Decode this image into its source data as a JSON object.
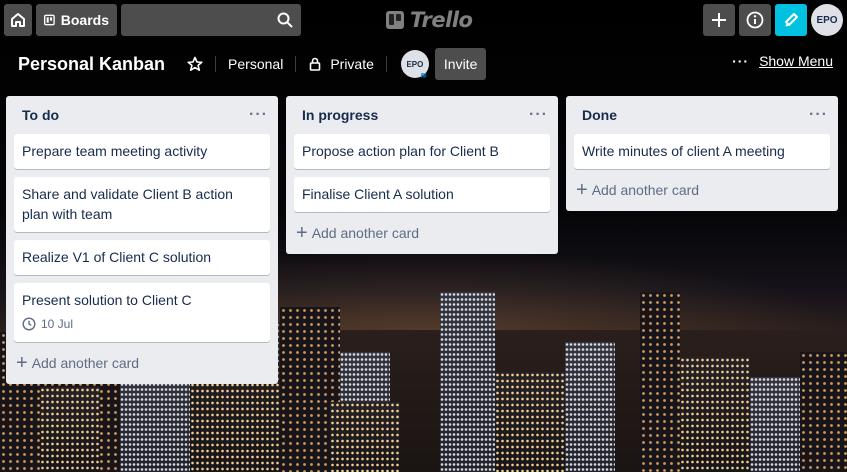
{
  "topbar": {
    "boards_label": "Boards",
    "search_value": "",
    "logo_text": "Trello",
    "avatar_initials": "EPO"
  },
  "board": {
    "title": "Personal Kanban",
    "team": "Personal",
    "visibility": "Private",
    "member_initials": "EPO",
    "invite_label": "Invite",
    "show_menu_label": "Show Menu"
  },
  "lists": [
    {
      "title": "To do",
      "cards": [
        {
          "text": "Prepare team meeting activity"
        },
        {
          "text": "Share and validate Client B action plan with team"
        },
        {
          "text": "Realize V1 of Client C solution"
        },
        {
          "text": "Present solution to Client C",
          "due": "10 Jul"
        }
      ],
      "add_label": "Add another card"
    },
    {
      "title": "In progress",
      "cards": [
        {
          "text": "Propose action plan for Client B"
        },
        {
          "text": "Finalise Client A solution"
        }
      ],
      "add_label": "Add another card"
    },
    {
      "title": "Done",
      "cards": [
        {
          "text": "Write minutes of client A meeting"
        }
      ],
      "add_label": "Add another card"
    }
  ],
  "colors": {
    "list_bg": "#ebecf0",
    "notif_accent": "#00c2e0",
    "text_primary": "#172b4d",
    "text_muted": "#5e6c84"
  }
}
